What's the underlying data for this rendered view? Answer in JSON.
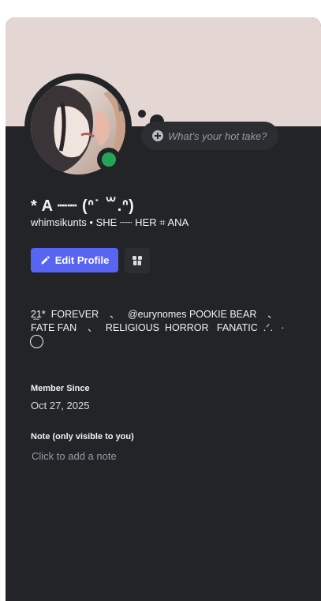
{
  "profile": {
    "hot_take_placeholder": "What’s your hot take?",
    "display_name": "* A ┈┈ (ᐢ˙ ꒳.ᐢ)",
    "username_line": "whimsikunts • SHE ┈┈ HER ⌗ ANA",
    "edit_profile_label": "Edit Profile",
    "status": "online",
    "bio": "2̲1*  FOREVER    、   @eurynomes POOKIE BEAR    、\nFATE FAN    、   RELIGIOUS  HORROR   FANATIC  .ᐟ.   ·",
    "member_since_label": "Member Since",
    "member_since_date": "Oct 27, 2025",
    "note_label": "Note (only visible to you)",
    "note_placeholder": "Click to add a note"
  },
  "colors": {
    "banner": "#e3d6d3",
    "card_bg": "#232428",
    "accent": "#5865f2",
    "online": "#23a55a"
  },
  "icons": {
    "hot_take": "plus-circle-icon",
    "edit": "pencil-icon",
    "badge": "shop-badge-icon"
  }
}
